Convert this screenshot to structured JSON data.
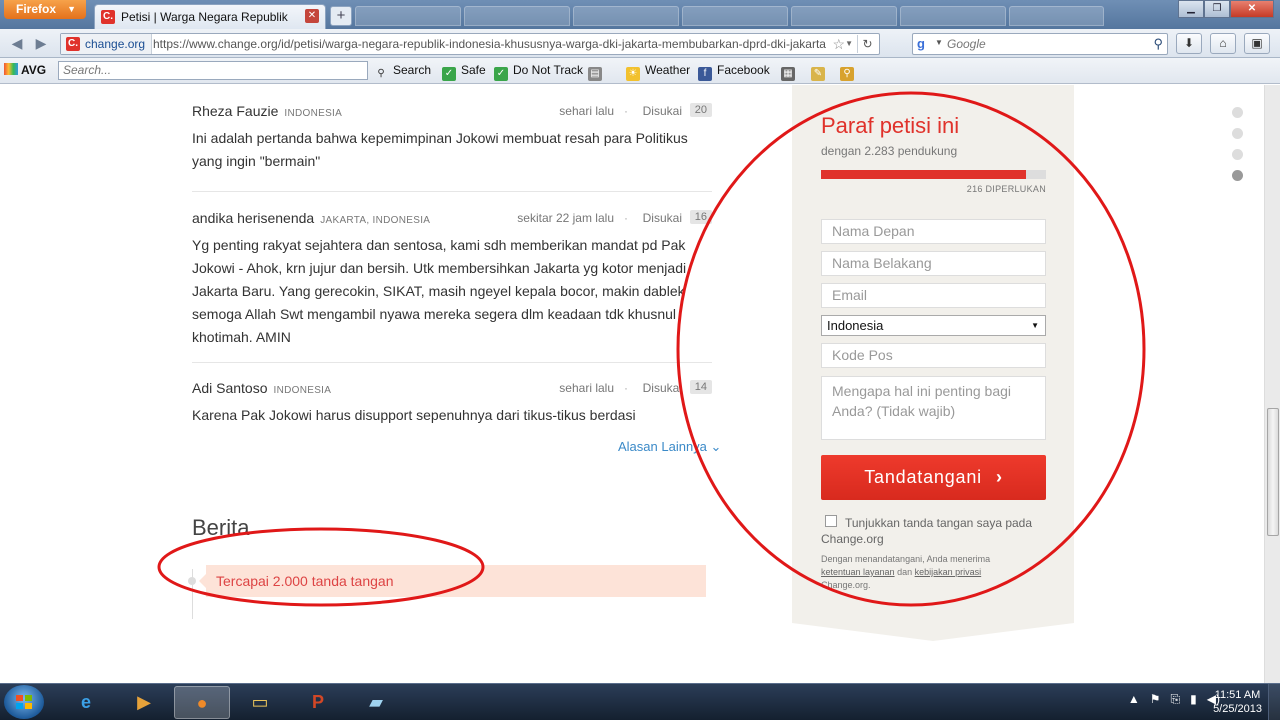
{
  "browser": {
    "firefox_menu": "Firefox",
    "active_tab": {
      "title": "Petisi | Warga Negara Republik Indonesi...",
      "favicon": "C."
    },
    "new_tab": "+",
    "url_site": "change.org",
    "url": "https://www.change.org/id/petisi/warga-negara-republik-indonesia-khususnya-warga-dki-jakarta-membubarkan-dprd-dki-jakarta",
    "search_placeholder": "Google",
    "search_engine_icon": "g"
  },
  "avg_toolbar": {
    "logo": "AVG",
    "search_placeholder": "Search...",
    "items": {
      "search": "Search",
      "safe": "Safe",
      "do_not_track": "Do Not Track",
      "weather": "Weather",
      "facebook": "Facebook"
    }
  },
  "comments": [
    {
      "name": "Rheza Fauzie",
      "location": "INDONESIA",
      "time": "sehari lalu",
      "like_label": "Disukai",
      "likes": "20",
      "text": "Ini adalah pertanda bahwa kepemimpinan Jokowi membuat resah para Politikus yang ingin \"bermain\""
    },
    {
      "name": "andika herisenenda",
      "location": "JAKARTA, INDONESIA",
      "time": "sekitar 22 jam lalu",
      "like_label": "Disukai",
      "likes": "16",
      "text": "Yg penting rakyat sejahtera dan sentosa, kami sdh memberikan mandat pd Pak Jokowi - Ahok, krn jujur dan bersih. Utk membersihkan Jakarta yg kotor menjadi Jakarta Baru. Yang gerecokin, SIKAT, masih ngeyel kepala bocor, makin dablek semoga Allah Swt mengambil nyawa mereka segera dlm keadaan tdk khusnul khotimah. AMIN"
    },
    {
      "name": "Adi Santoso",
      "location": "INDONESIA",
      "time": "sehari lalu",
      "like_label": "Disukai",
      "likes": "14",
      "text": "Karena Pak Jokowi harus disupport sepenuhnya dari tikus-tikus berdasi"
    }
  ],
  "more_reasons": "Alasan Lainnya",
  "news": {
    "title": "Berita",
    "item": "Tercapai 2.000 tanda tangan"
  },
  "sign": {
    "title": "Paraf petisi ini",
    "supporters": "dengan 2.283 pendukung",
    "progress_fraction": 0.91,
    "needed": "216 DIPERLUKAN",
    "first_name_placeholder": "Nama Depan",
    "last_name_placeholder": "Nama Belakang",
    "email_placeholder": "Email",
    "country": "Indonesia",
    "postcode_placeholder": "Kode Pos",
    "reason_placeholder": "Mengapa hal ini penting bagi Anda? (Tidak wajib)",
    "button": "Tandatangani",
    "show_signature": "Tunjukkan tanda tangan saya pada Change.org",
    "legal_prefix": "Dengan menandatangani, Anda menerima",
    "legal_terms": "ketentuan layanan",
    "legal_and": "dan",
    "legal_privacy": "kebijakan privasi",
    "legal_suffix": "Change.org."
  },
  "taskbar": {
    "time": "11:51 AM",
    "date": "5/25/2013"
  },
  "colors": {
    "accent": "#e0322b",
    "link": "#3b8ac8",
    "annotation": "#e01818"
  }
}
